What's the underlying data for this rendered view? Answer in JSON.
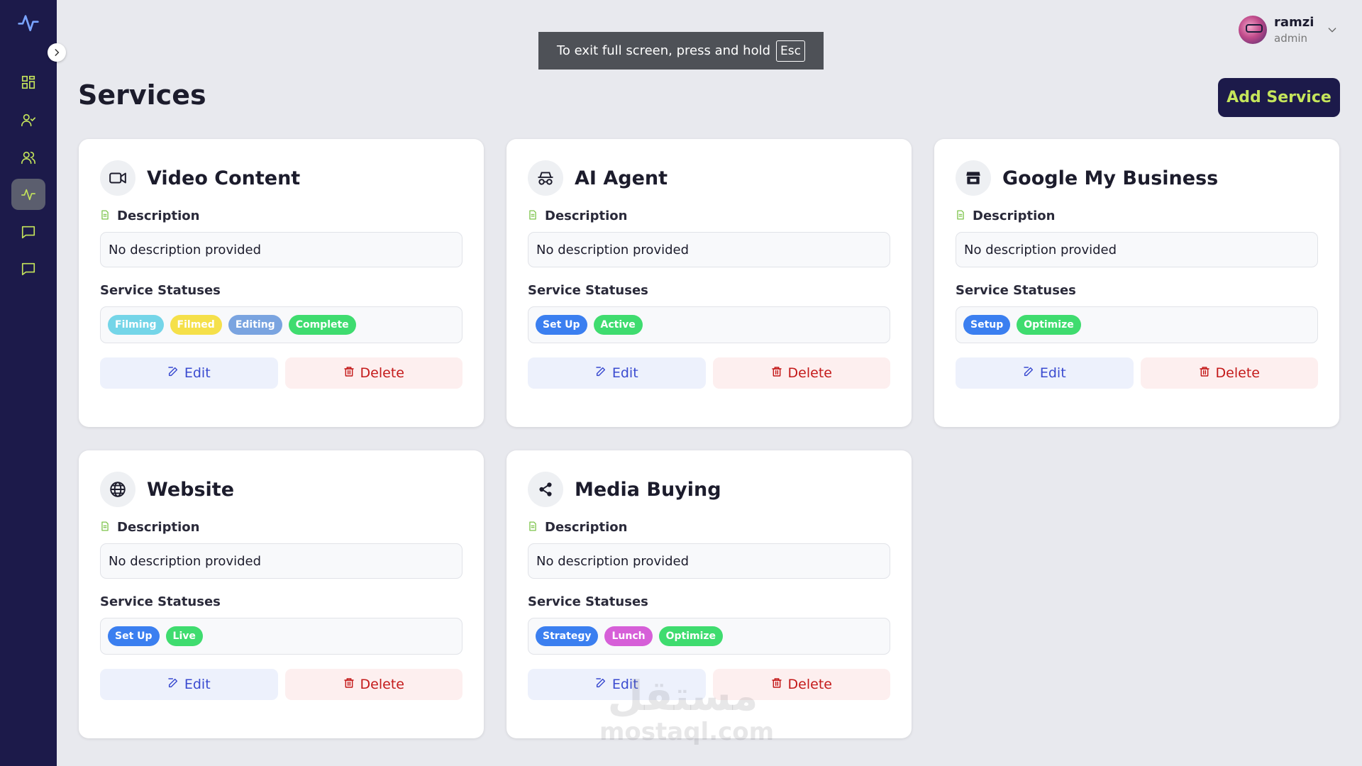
{
  "sidebar": {
    "logo_icon": "activity-icon",
    "items": [
      {
        "name": "dashboard",
        "icon": "grid-icon",
        "active": false
      },
      {
        "name": "user-check",
        "icon": "user-check-icon",
        "active": false
      },
      {
        "name": "users",
        "icon": "users-icon",
        "active": false
      },
      {
        "name": "services",
        "icon": "activity-icon",
        "active": true
      },
      {
        "name": "messages",
        "icon": "message-icon",
        "active": false
      },
      {
        "name": "chat",
        "icon": "message-icon",
        "active": false
      }
    ]
  },
  "fullscreen_toast": {
    "text": "To exit full screen, press and hold",
    "key": "Esc"
  },
  "user": {
    "name": "ramzi",
    "role": "admin"
  },
  "page": {
    "title": "Services",
    "add_button": "Add Service"
  },
  "labels": {
    "description": "Description",
    "statuses": "Service Statuses",
    "edit": "Edit",
    "delete": "Delete"
  },
  "colors": {
    "sidebar_bg": "#1c1a4a",
    "accent": "#c5e55b",
    "edit_text": "#3a4bd0",
    "delete_text": "#c41a1a"
  },
  "services": [
    {
      "title": "Video Content",
      "icon": "video-icon",
      "description": "No description provided",
      "statuses": [
        {
          "label": "Filming",
          "color": "#74d5e8"
        },
        {
          "label": "Filmed",
          "color": "#f5e04a"
        },
        {
          "label": "Editing",
          "color": "#7aa4e0"
        },
        {
          "label": "Complete",
          "color": "#3fdc6f"
        }
      ]
    },
    {
      "title": "AI Agent",
      "icon": "incognito-icon",
      "description": "No description provided",
      "statuses": [
        {
          "label": "Set Up",
          "color": "#3b7ff0"
        },
        {
          "label": "Active",
          "color": "#3fdc6f"
        }
      ]
    },
    {
      "title": "Google My Business",
      "icon": "store-icon",
      "description": "No description provided",
      "statuses": [
        {
          "label": "Setup",
          "color": "#3b7ff0"
        },
        {
          "label": "Optimize",
          "color": "#3fdc6f"
        }
      ]
    },
    {
      "title": "Website",
      "icon": "globe-icon",
      "description": "No description provided",
      "statuses": [
        {
          "label": "Set Up",
          "color": "#3b7ff0"
        },
        {
          "label": "Live",
          "color": "#3fdc6f"
        }
      ]
    },
    {
      "title": "Media Buying",
      "icon": "share-icon",
      "description": "No description provided",
      "statuses": [
        {
          "label": "Strategy",
          "color": "#3b7ff0"
        },
        {
          "label": "Lunch",
          "color": "#d65fd8"
        },
        {
          "label": "Optimize",
          "color": "#3fdc6f"
        }
      ]
    }
  ],
  "watermark": {
    "arabic": "مستقل",
    "latin": "mostaql.com"
  }
}
